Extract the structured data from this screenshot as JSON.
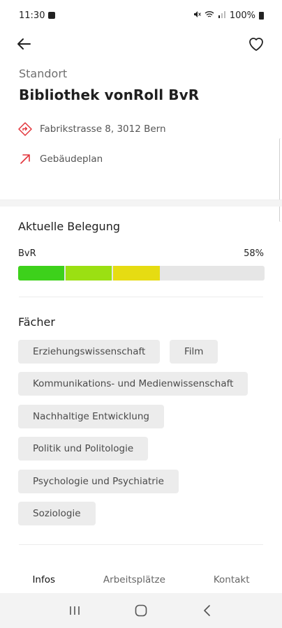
{
  "status_bar": {
    "time": "11:30",
    "battery": "100%"
  },
  "header": {
    "eyebrow": "Standort",
    "title": "Bibliothek vonRoll BvR"
  },
  "info": {
    "address": "Fabrikstrasse 8, 3012 Bern",
    "plan_link": "Gebäudeplan"
  },
  "occupancy": {
    "section_title": "Aktuelle Belegung",
    "label": "BvR",
    "percent_text": "58%",
    "value_percent": 58,
    "segment_colors": [
      "#3dd11b",
      "#9be012",
      "#e6dc12"
    ],
    "track_color": "#e6e6e6"
  },
  "subjects": {
    "section_title": "Fächer",
    "items": [
      "Erziehungswissenschaft",
      "Film",
      "Kommunikations- und Medienwissenschaft",
      "Nachhaltige Entwicklung",
      "Politik und Politologie",
      "Psychologie und Psychiatrie",
      "Soziologie"
    ]
  },
  "tabs": [
    {
      "label": "Infos",
      "active": true
    },
    {
      "label": "Arbeitsplätze",
      "active": false
    },
    {
      "label": "Kontakt",
      "active": false
    }
  ],
  "colors": {
    "accent": "#e2353c"
  }
}
